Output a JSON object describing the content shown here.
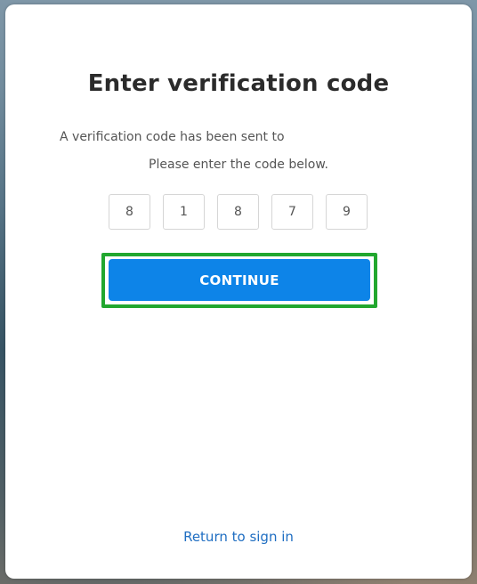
{
  "dialog": {
    "title": "Enter verification code",
    "message_line1": "A verification code has been sent to",
    "message_line2": "Please enter the code below.",
    "code_digits": [
      "8",
      "1",
      "8",
      "7",
      "9"
    ],
    "continue_label": "CONTINUE",
    "return_link": "Return to sign in"
  },
  "colors": {
    "accent": "#0d84e8",
    "focus_ring": "#22a72f",
    "link": "#1f6ec2"
  }
}
